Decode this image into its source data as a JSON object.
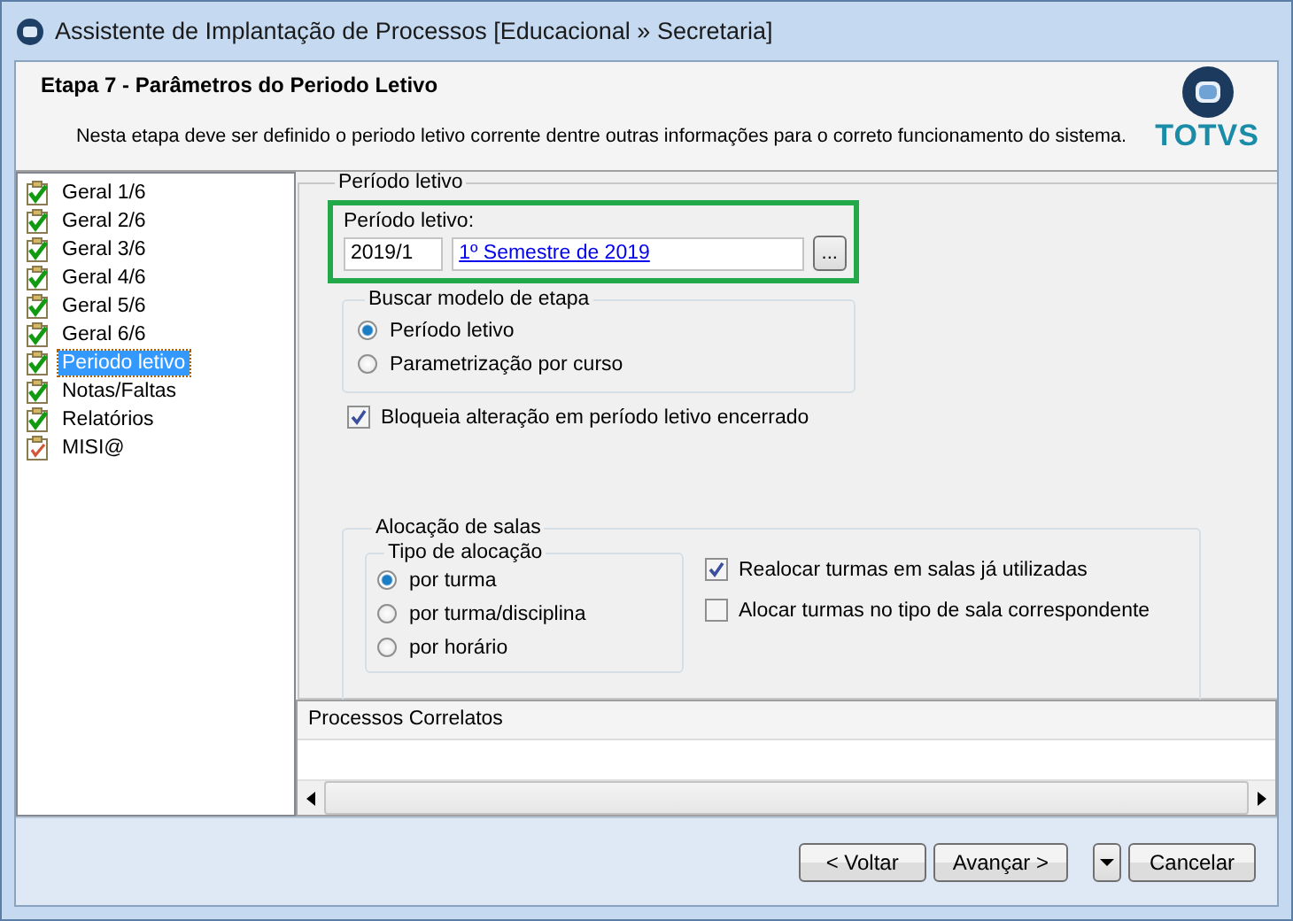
{
  "window": {
    "title": "Assistente de Implantação de Processos [Educacional » Secretaria]"
  },
  "header": {
    "title": "Etapa 7 - Parâmetros do Periodo Letivo",
    "description": "Nesta etapa deve ser definido o periodo letivo corrente dentre outras informações para o correto funcionamento do sistema.",
    "logo_text": "TOTVS"
  },
  "sidebar": {
    "items": [
      {
        "label": "Geral 1/6",
        "completed": true,
        "selected": false
      },
      {
        "label": "Geral 2/6",
        "completed": true,
        "selected": false
      },
      {
        "label": "Geral 3/6",
        "completed": true,
        "selected": false
      },
      {
        "label": "Geral 4/6",
        "completed": true,
        "selected": false
      },
      {
        "label": "Geral 5/6",
        "completed": true,
        "selected": false
      },
      {
        "label": "Geral 6/6",
        "completed": true,
        "selected": false
      },
      {
        "label": "Periodo letivo",
        "completed": true,
        "selected": true
      },
      {
        "label": "Notas/Faltas",
        "completed": true,
        "selected": false
      },
      {
        "label": "Relatórios",
        "completed": true,
        "selected": false
      },
      {
        "label": "MISI@",
        "completed": false,
        "selected": false
      }
    ]
  },
  "periodo_group": {
    "title": "Período letivo",
    "field_label": "Período letivo:",
    "code_value": "2019/1",
    "description_link": "1º Semestre de 2019",
    "browse_button": "...",
    "modelo_group": {
      "title": "Buscar modelo de etapa",
      "options": [
        {
          "label": "Período letivo",
          "selected": true
        },
        {
          "label": "Parametrização por curso",
          "selected": false
        }
      ]
    },
    "bloqueia": {
      "label": "Bloqueia alteração em período letivo encerrado",
      "checked": true
    }
  },
  "alocacao_group": {
    "title": "Alocação de salas",
    "tipo_group": {
      "title": "Tipo de alocação",
      "options": [
        {
          "label": "por turma",
          "selected": true
        },
        {
          "label": "por turma/disciplina",
          "selected": false
        },
        {
          "label": "por horário",
          "selected": false
        }
      ]
    },
    "checkboxes": [
      {
        "label": "Realocar turmas em salas já utilizadas",
        "checked": true
      },
      {
        "label": "Alocar turmas no tipo de sala correspondente",
        "checked": false
      }
    ]
  },
  "related_panel": {
    "title": "Processos Correlatos"
  },
  "buttons": [
    {
      "kind": "button",
      "label": "< Voltar"
    },
    {
      "kind": "button",
      "label": "Avançar >"
    },
    {
      "kind": "dropdown"
    },
    {
      "kind": "button",
      "label": "Cancelar"
    }
  ]
}
